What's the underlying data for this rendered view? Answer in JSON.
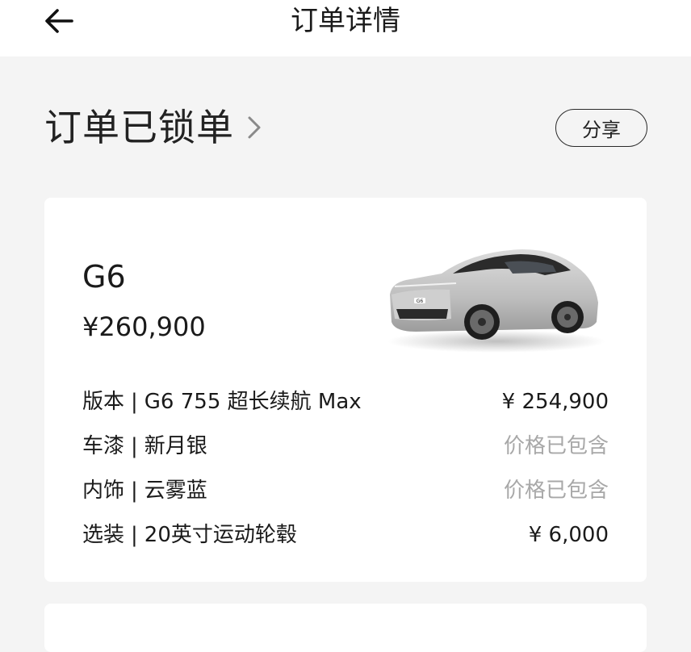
{
  "header": {
    "title": "订单详情",
    "back_icon": "arrow-left-icon"
  },
  "status": {
    "text": "订单已锁单",
    "chevron_icon": "chevron-right-icon",
    "share_label": "分享"
  },
  "order": {
    "model": "G6",
    "price": "¥260,900",
    "car_image_icon": "car-image",
    "car_badge": "G6",
    "specs": [
      {
        "label": "版本",
        "separator": "|",
        "value": "G6 755 超长续航 Max",
        "price": "¥ 254,900",
        "muted": false
      },
      {
        "label": "车漆",
        "separator": "|",
        "value": "新月银",
        "price": "价格已包含",
        "muted": true
      },
      {
        "label": "内饰",
        "separator": "|",
        "value": "云雾蓝",
        "price": "价格已包含",
        "muted": true
      },
      {
        "label": "选装",
        "separator": "|",
        "value": "20英寸运动轮毂",
        "price": "¥ 6,000",
        "muted": false
      }
    ]
  },
  "colors": {
    "background": "#f4f4f4",
    "card": "#ffffff",
    "muted_text": "#a8a8a8",
    "car_body": "#c9c9c9"
  }
}
